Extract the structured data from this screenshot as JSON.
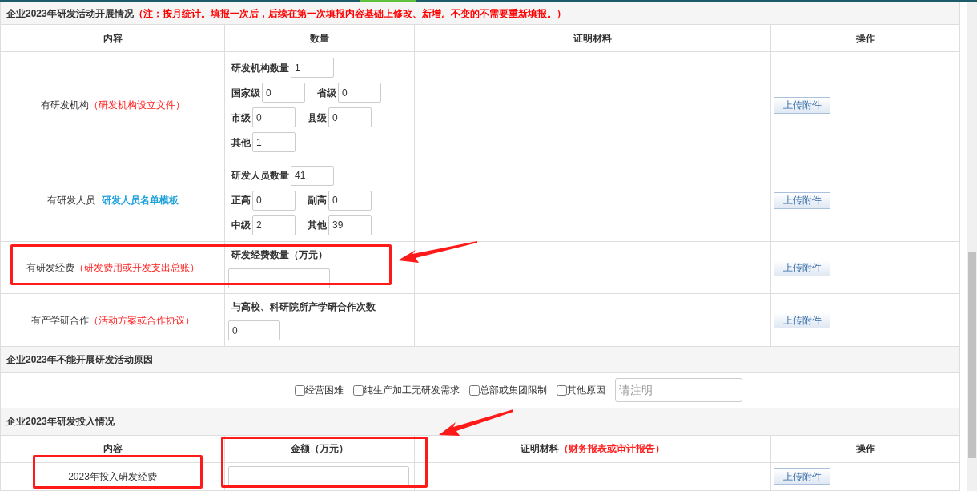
{
  "activity_section": {
    "title": "企业2023年研发活动开展情况",
    "note": "（注：按月统计。填报一次后，后续在第一次填报内容基础上修改、新增。不变的不需要重新填报。）",
    "columns": [
      {
        "label": "内容"
      },
      {
        "label": "数量"
      },
      {
        "label": "证明材料"
      },
      {
        "label": "操作"
      }
    ],
    "rows": [
      {
        "label": "有研发机构",
        "attachment": {
          "kind": "note",
          "text": "（研发机构设立文件）"
        },
        "lines": [
          [
            {
              "label": "研发机构数量",
              "value": "1"
            }
          ],
          [
            {
              "label": "国家级",
              "value": "0"
            },
            {
              "label": "省级",
              "value": "0"
            }
          ],
          [
            {
              "label": "市级",
              "value": "0"
            },
            {
              "label": "县级",
              "value": "0"
            }
          ],
          [
            {
              "label": "其他",
              "value": "1"
            }
          ]
        ],
        "button": "上传附件"
      },
      {
        "label": "有研发人员",
        "attachment": {
          "kind": "link",
          "text": "研发人员名单模板"
        },
        "lines": [
          [
            {
              "label": "研发人员数量",
              "value": "41"
            }
          ],
          [
            {
              "label": "正高",
              "value": "0"
            },
            {
              "label": "副高",
              "value": "0"
            }
          ],
          [
            {
              "label": "中级",
              "value": "2"
            },
            {
              "label": "其他",
              "value": "39"
            }
          ]
        ],
        "button": "上传附件"
      },
      {
        "label": "有研发经费",
        "attachment": {
          "kind": "note",
          "text": "（研发费用或开发支出总账）"
        },
        "heading": "研发经费数量（万元）",
        "input": {
          "kind": "wide"
        },
        "button": "上传附件"
      },
      {
        "label": "有产学研合作",
        "attachment": {
          "kind": "note",
          "text": "（活动方案或合作协议）"
        },
        "heading": "与高校、科研院所产学研合作次数",
        "input": {
          "kind": "narrow",
          "value": "0"
        },
        "button": "上传附件"
      }
    ]
  },
  "reason_section": {
    "title": "企业2023年不能开展研发活动原因",
    "reasons": [
      {
        "label": "经营困难",
        "checked": false
      },
      {
        "label": "纯生产加工无研发需求",
        "checked": false
      },
      {
        "label": "总部或集团限制",
        "checked": false
      },
      {
        "label": "其他原因",
        "checked": false
      }
    ],
    "other_field": {
      "placeholder": "请注明"
    }
  },
  "investment_section": {
    "title": "企业2023年研发投入情况",
    "columns": [
      {
        "label": "内容"
      },
      {
        "label": "金额（万元）"
      },
      {
        "label": "证明材料",
        "note": "（财务报表或审计报告）"
      },
      {
        "label": "操作"
      }
    ],
    "rows": [
      {
        "label": "2023年投入研发经费",
        "button": "上传附件"
      }
    ]
  }
}
